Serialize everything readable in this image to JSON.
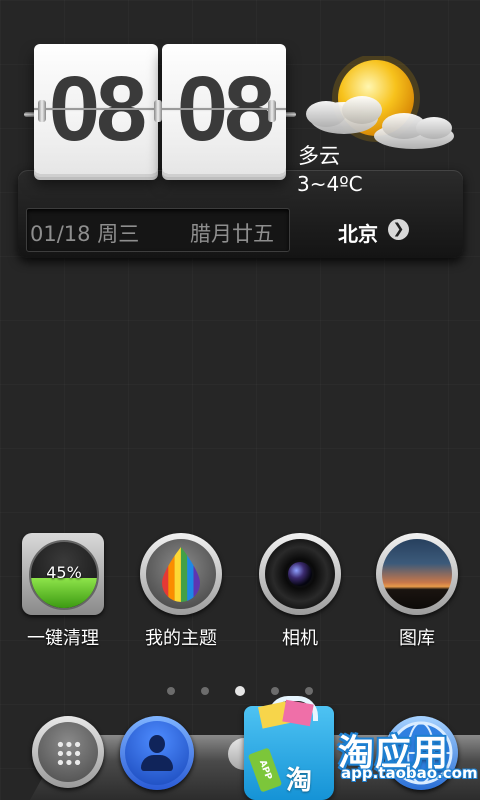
{
  "clock": {
    "hours": "08",
    "minutes": "08"
  },
  "weather": {
    "condition": "多云",
    "temperature": "3~4ºC",
    "icon": "partly-cloudy-icon"
  },
  "date": {
    "gregorian": "01/18 周三",
    "lunar": "腊月廿五",
    "city": "北京",
    "city_icon": "chevron-right-circle-icon"
  },
  "apps": [
    {
      "label": "一键清理",
      "icon": "memory-cleaner-icon",
      "percent_label": "45%",
      "fill_percent": 45
    },
    {
      "label": "我的主题",
      "icon": "theme-drop-icon"
    },
    {
      "label": "相机",
      "icon": "camera-lens-icon"
    },
    {
      "label": "图库",
      "icon": "gallery-landscape-icon"
    }
  ],
  "pager": {
    "pages": 5,
    "current": 3
  },
  "dock": [
    {
      "name": "phone-dialer",
      "icon": "keypad-icon"
    },
    {
      "name": "contacts",
      "icon": "person-icon"
    },
    {
      "name": "app-drawer",
      "icon": "dock-center-icon"
    },
    {
      "name": "browser",
      "icon": "globe-icon"
    }
  ],
  "watermark": {
    "title": "淘应用",
    "url": "app.taobao.com",
    "bag_tag": "APP",
    "bag_char": "淘"
  },
  "colors": {
    "accent_blue": "#1d7fd0",
    "cleaner_green": "#6cc930",
    "background": "#262626"
  }
}
